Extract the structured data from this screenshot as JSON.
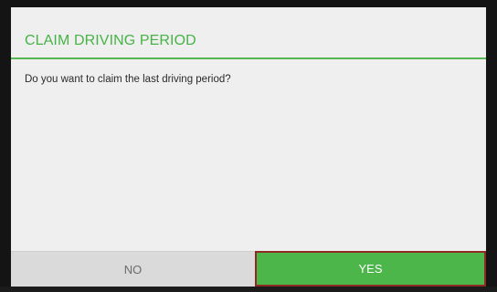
{
  "dialog": {
    "title": "CLAIM DRIVING PERIOD",
    "message": "Do you want to claim the last driving period?",
    "no_label": "NO",
    "yes_label": "YES"
  },
  "colors": {
    "accent": "#47b347",
    "yes_button": "#4cb64b",
    "yes_focus_border": "#8e2a24",
    "no_button": "#dadada",
    "dialog_background": "#efefef",
    "screen_background": "#141414"
  }
}
